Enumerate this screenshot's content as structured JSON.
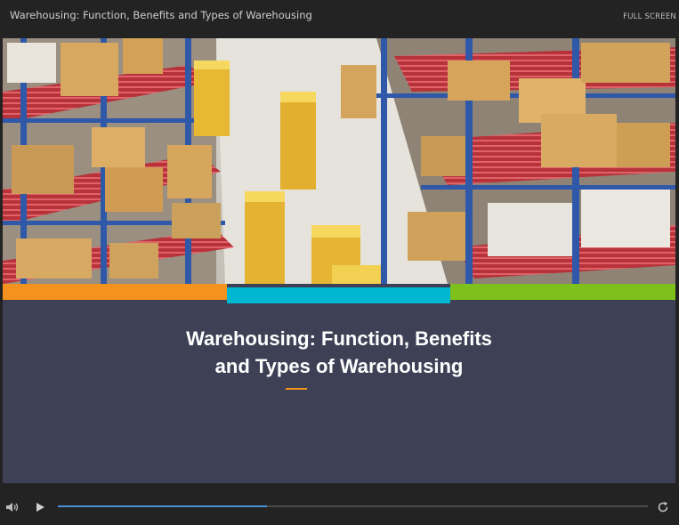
{
  "window": {
    "title": "Warehousing: Function, Benefits and Types of Warehousing",
    "fullscreen_label": "FULL SCREEN"
  },
  "slide": {
    "title_line1": "Warehousing: Function, Benefits",
    "title_line2": "and Types of Warehousing",
    "hero_image": "warehouse-shelves-with-boxes-and-robots",
    "bar_colors": [
      "#f3921e",
      "#00b7d1",
      "#7ec11c"
    ],
    "accent_color": "#f3921e",
    "background_color": "#3e4055"
  },
  "player": {
    "progress_fraction": 0.355,
    "icons": [
      "volume-icon",
      "play-icon",
      "replay-icon"
    ],
    "progress_color": "#4a90d9"
  }
}
